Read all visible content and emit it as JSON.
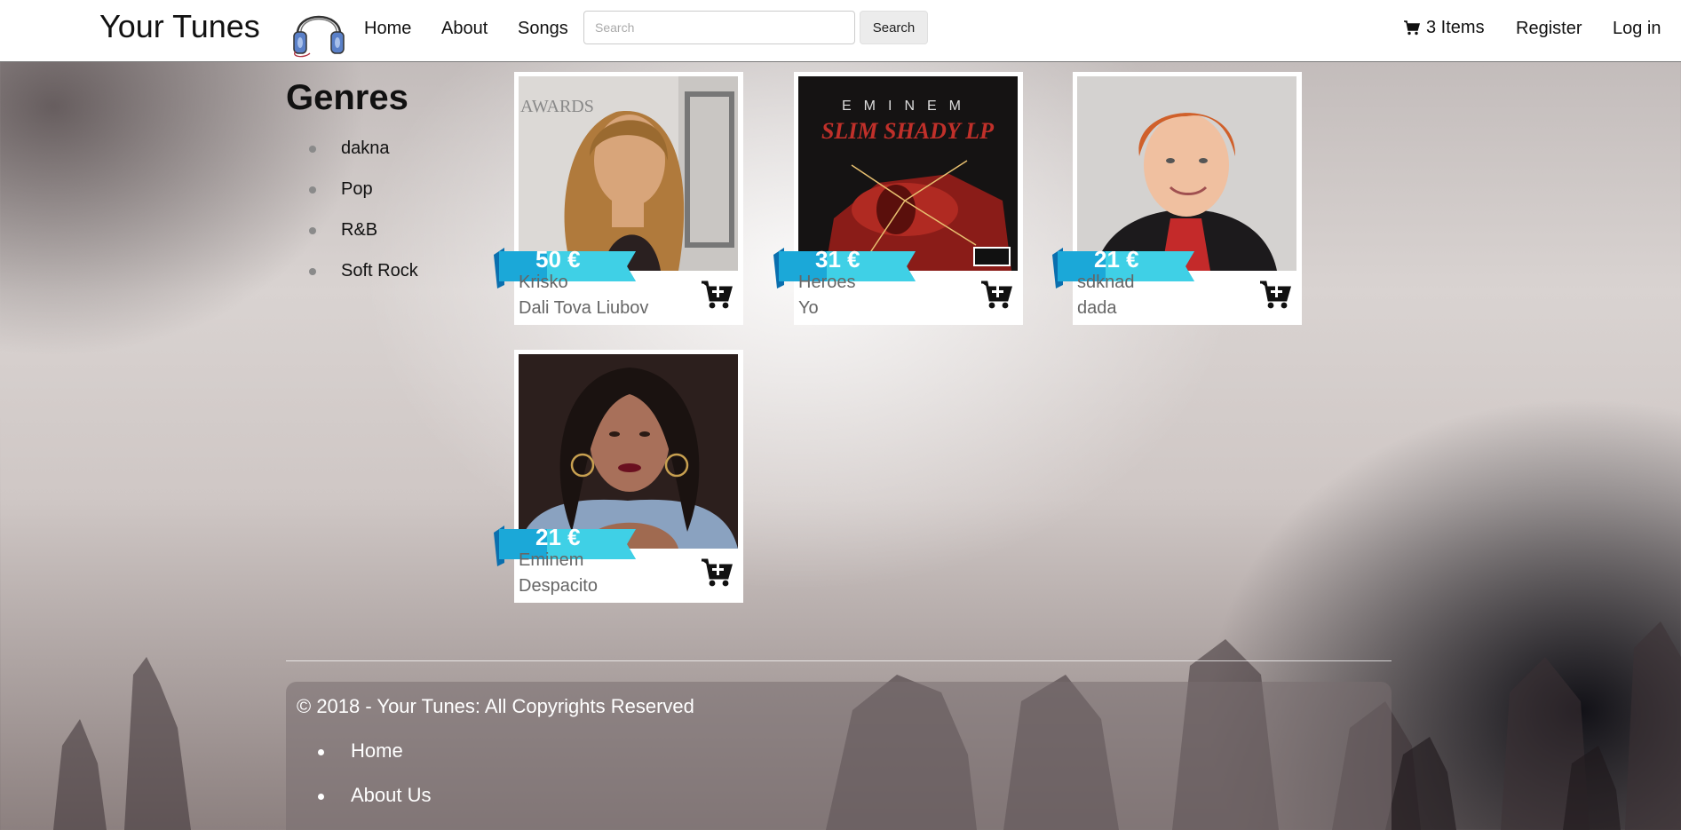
{
  "header": {
    "brand": "Your Tunes",
    "nav": [
      "Home",
      "About",
      "Songs"
    ],
    "search": {
      "placeholder": "Search",
      "value": "",
      "button_label": "Search"
    },
    "cart_label": "3 Items",
    "register_label": "Register",
    "login_label": "Log in"
  },
  "sidebar": {
    "title": "Genres",
    "genres": [
      "dakna",
      "Pop",
      "R&B",
      "Soft Rock"
    ]
  },
  "songs": [
    {
      "price": "50 €",
      "artist": "Krisko",
      "title": "Dali Tova Liubov",
      "art": "portrait-woman-blonde"
    },
    {
      "price": "31 €",
      "artist": "Heroes",
      "title": "Yo",
      "art": "album-cover-eminem-slim-shady-lp"
    },
    {
      "price": "21 €",
      "artist": "sdknad",
      "title": "dada",
      "art": "portrait-man-red-hair"
    },
    {
      "price": "21 €",
      "artist": "Eminem",
      "title": "Despacito",
      "art": "portrait-woman-dark-hair"
    }
  ],
  "album_cover_text": {
    "band": "EMINEM",
    "album": "SLIM SHADY LP",
    "awards_text": "AWARDS"
  },
  "footer": {
    "copyright": "© 2018 - Your Tunes: All Copyrights Reserved",
    "links": [
      "Home",
      "About Us"
    ]
  },
  "colors": {
    "ribbon": "#1ba8d8",
    "ribbon_light": "#3fd0e6",
    "ribbon_dark": "#0a6fae"
  }
}
